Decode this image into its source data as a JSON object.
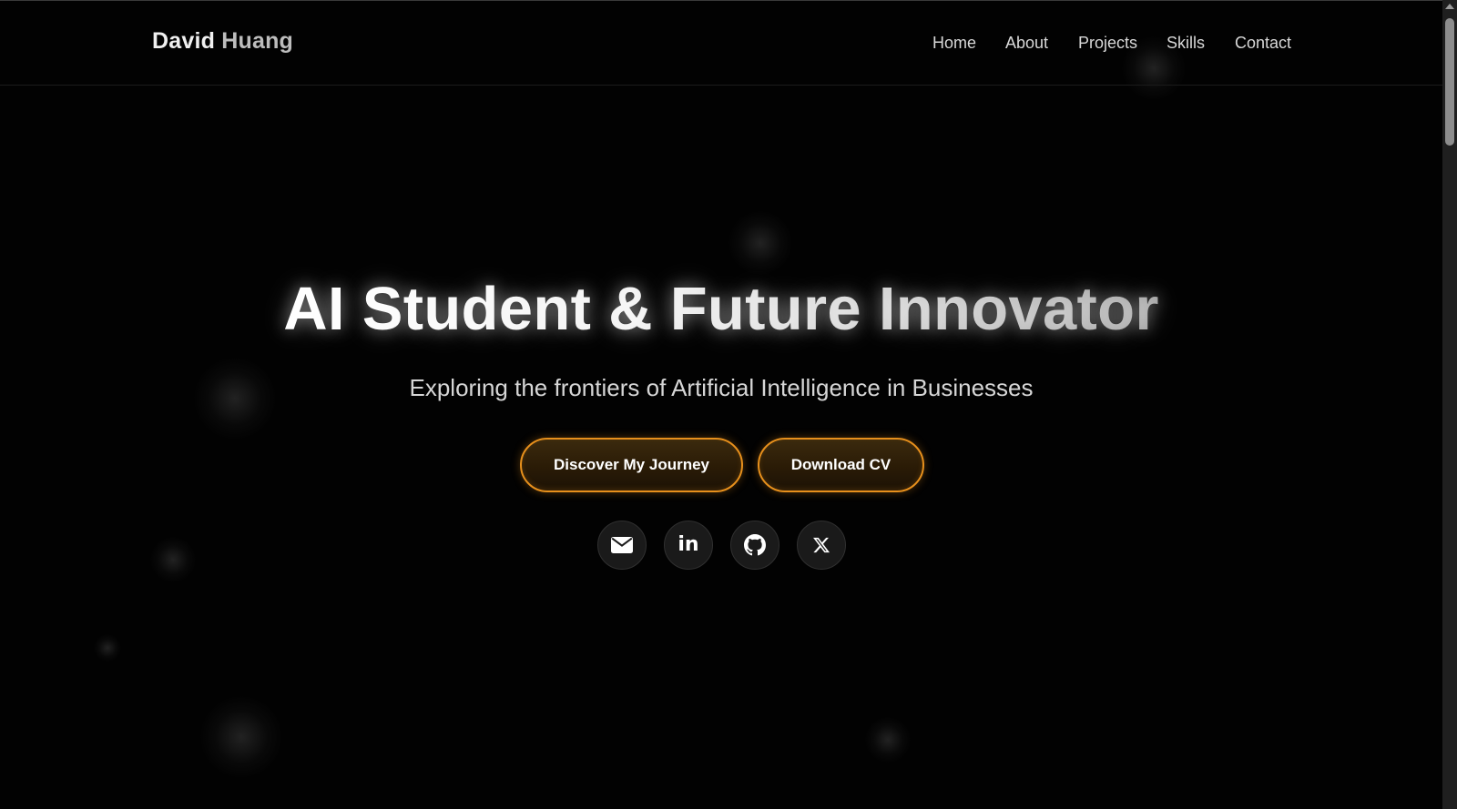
{
  "navbar": {
    "logo_first": "David",
    "logo_last": "Huang",
    "links": [
      {
        "label": "Home"
      },
      {
        "label": "About"
      },
      {
        "label": "Projects"
      },
      {
        "label": "Skills"
      },
      {
        "label": "Contact"
      }
    ]
  },
  "hero": {
    "title_part1": "AI Student & Future ",
    "title_part2": "Innovator",
    "subtitle": "Exploring the frontiers of Artificial Intelligence in Businesses",
    "primary_button": "Discover My Journey",
    "secondary_button": "Download CV",
    "socials": [
      {
        "icon": "envelope-icon"
      },
      {
        "icon": "linkedin-icon",
        "text": "in"
      },
      {
        "icon": "github-icon"
      },
      {
        "icon": "x-icon"
      }
    ]
  },
  "colors": {
    "background": "#020202",
    "accent": "#e7901c",
    "text": "#f0f0f0"
  }
}
